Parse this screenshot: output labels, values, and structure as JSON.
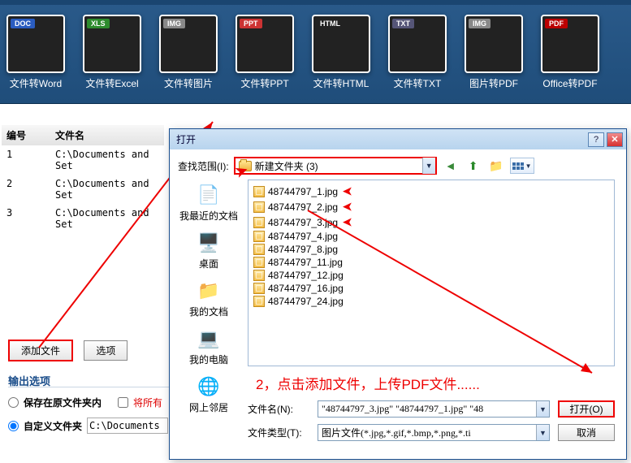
{
  "toolbar": [
    {
      "badge": "DOC",
      "label": "文件转Word",
      "cls": "doc"
    },
    {
      "badge": "XLS",
      "label": "文件转Excel",
      "cls": "xls"
    },
    {
      "badge": "IMG",
      "label": "文件转图片",
      "cls": "img"
    },
    {
      "badge": "PPT",
      "label": "文件转PPT",
      "cls": "ppt"
    },
    {
      "badge": "HTML",
      "label": "文件转HTML",
      "cls": "html"
    },
    {
      "badge": "TXT",
      "label": "文件转TXT",
      "cls": "txt"
    },
    {
      "badge": "IMG",
      "label": "图片转PDF",
      "cls": "imgp"
    },
    {
      "badge": "PDF",
      "label": "Office转PDF",
      "cls": "pdf"
    }
  ],
  "table": {
    "headers": {
      "col1": "编号",
      "col2": "文件名"
    },
    "rows": [
      {
        "n": "1",
        "name": "C:\\Documents and Set"
      },
      {
        "n": "2",
        "name": "C:\\Documents and Set"
      },
      {
        "n": "3",
        "name": "C:\\Documents and Set"
      }
    ]
  },
  "buttons": {
    "add": "添加文件",
    "options": "选项"
  },
  "output": {
    "title": "输出选项",
    "opt1": "保存在原文件夹内",
    "chk2_label": "将所有",
    "opt2": "自定义文件夹",
    "path": "C:\\Documents a"
  },
  "dialog": {
    "title": "打开",
    "lookin_label": "查找范围(I):",
    "lookin_value": "新建文件夹 (3)",
    "places": [
      "我最近的文档",
      "桌面",
      "我的文档",
      "我的电脑",
      "网上邻居"
    ],
    "files": [
      "48744797_1.jpg",
      "48744797_2.jpg",
      "48744797_3.jpg",
      "48744797_4.jpg",
      "48744797_8.jpg",
      "48744797_11.jpg",
      "48744797_12.jpg",
      "48744797_16.jpg",
      "48744797_24.jpg"
    ],
    "arrow_files": [
      0,
      1,
      2
    ],
    "annotation": "2，点击添加文件，上传PDF文件......",
    "filename_label": "文件名(N):",
    "filename_value": "\"48744797_3.jpg\" \"48744797_1.jpg\" \"48",
    "filetype_label": "文件类型(T):",
    "filetype_value": "图片文件(*.jpg,*.gif,*.bmp,*.png,*.ti",
    "open_btn": "打开(O)",
    "cancel_btn": "取消"
  }
}
